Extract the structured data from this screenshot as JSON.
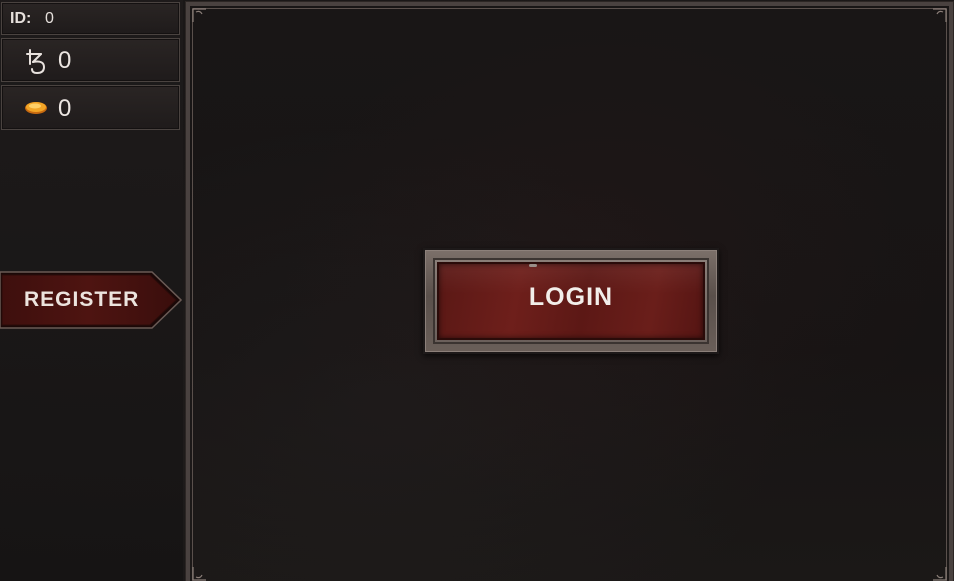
{
  "stats": {
    "id_label": "ID:",
    "id_value": "0",
    "tez_icon": "tezos-icon",
    "tez_value": "0",
    "coin_icon": "gold-coin-icon",
    "coin_value": "0"
  },
  "register": {
    "label": "REGISTER"
  },
  "login": {
    "label": "LOGIN"
  },
  "colors": {
    "button_red": "#6a1e1a",
    "frame_stone": "#6b605b",
    "background": "#171414",
    "coin": "#f0a020"
  }
}
